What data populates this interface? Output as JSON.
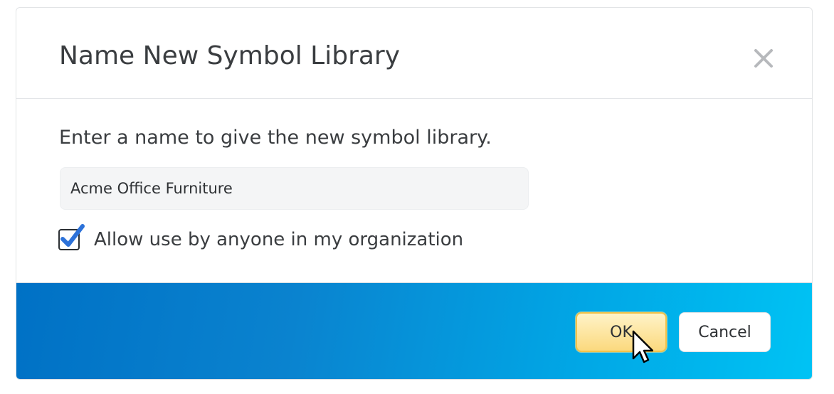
{
  "dialog": {
    "title": "Name New Symbol Library",
    "close_icon": "close-icon",
    "prompt": "Enter a name to give the new symbol library.",
    "name_input": {
      "value": "Acme Office Furniture",
      "placeholder": ""
    },
    "share_checkbox": {
      "checked": true,
      "label": "Allow use by anyone in my organization",
      "check_color": "#2d72d9"
    },
    "buttons": {
      "ok_label": "OK",
      "cancel_label": "Cancel"
    }
  },
  "colors": {
    "footer_gradient_start": "#0071c5",
    "footer_gradient_end": "#00c3f4",
    "ok_button": "#fbd97e",
    "title_text": "#3a3d40"
  },
  "cursor": {
    "icon": "arrow-pointer-icon"
  }
}
